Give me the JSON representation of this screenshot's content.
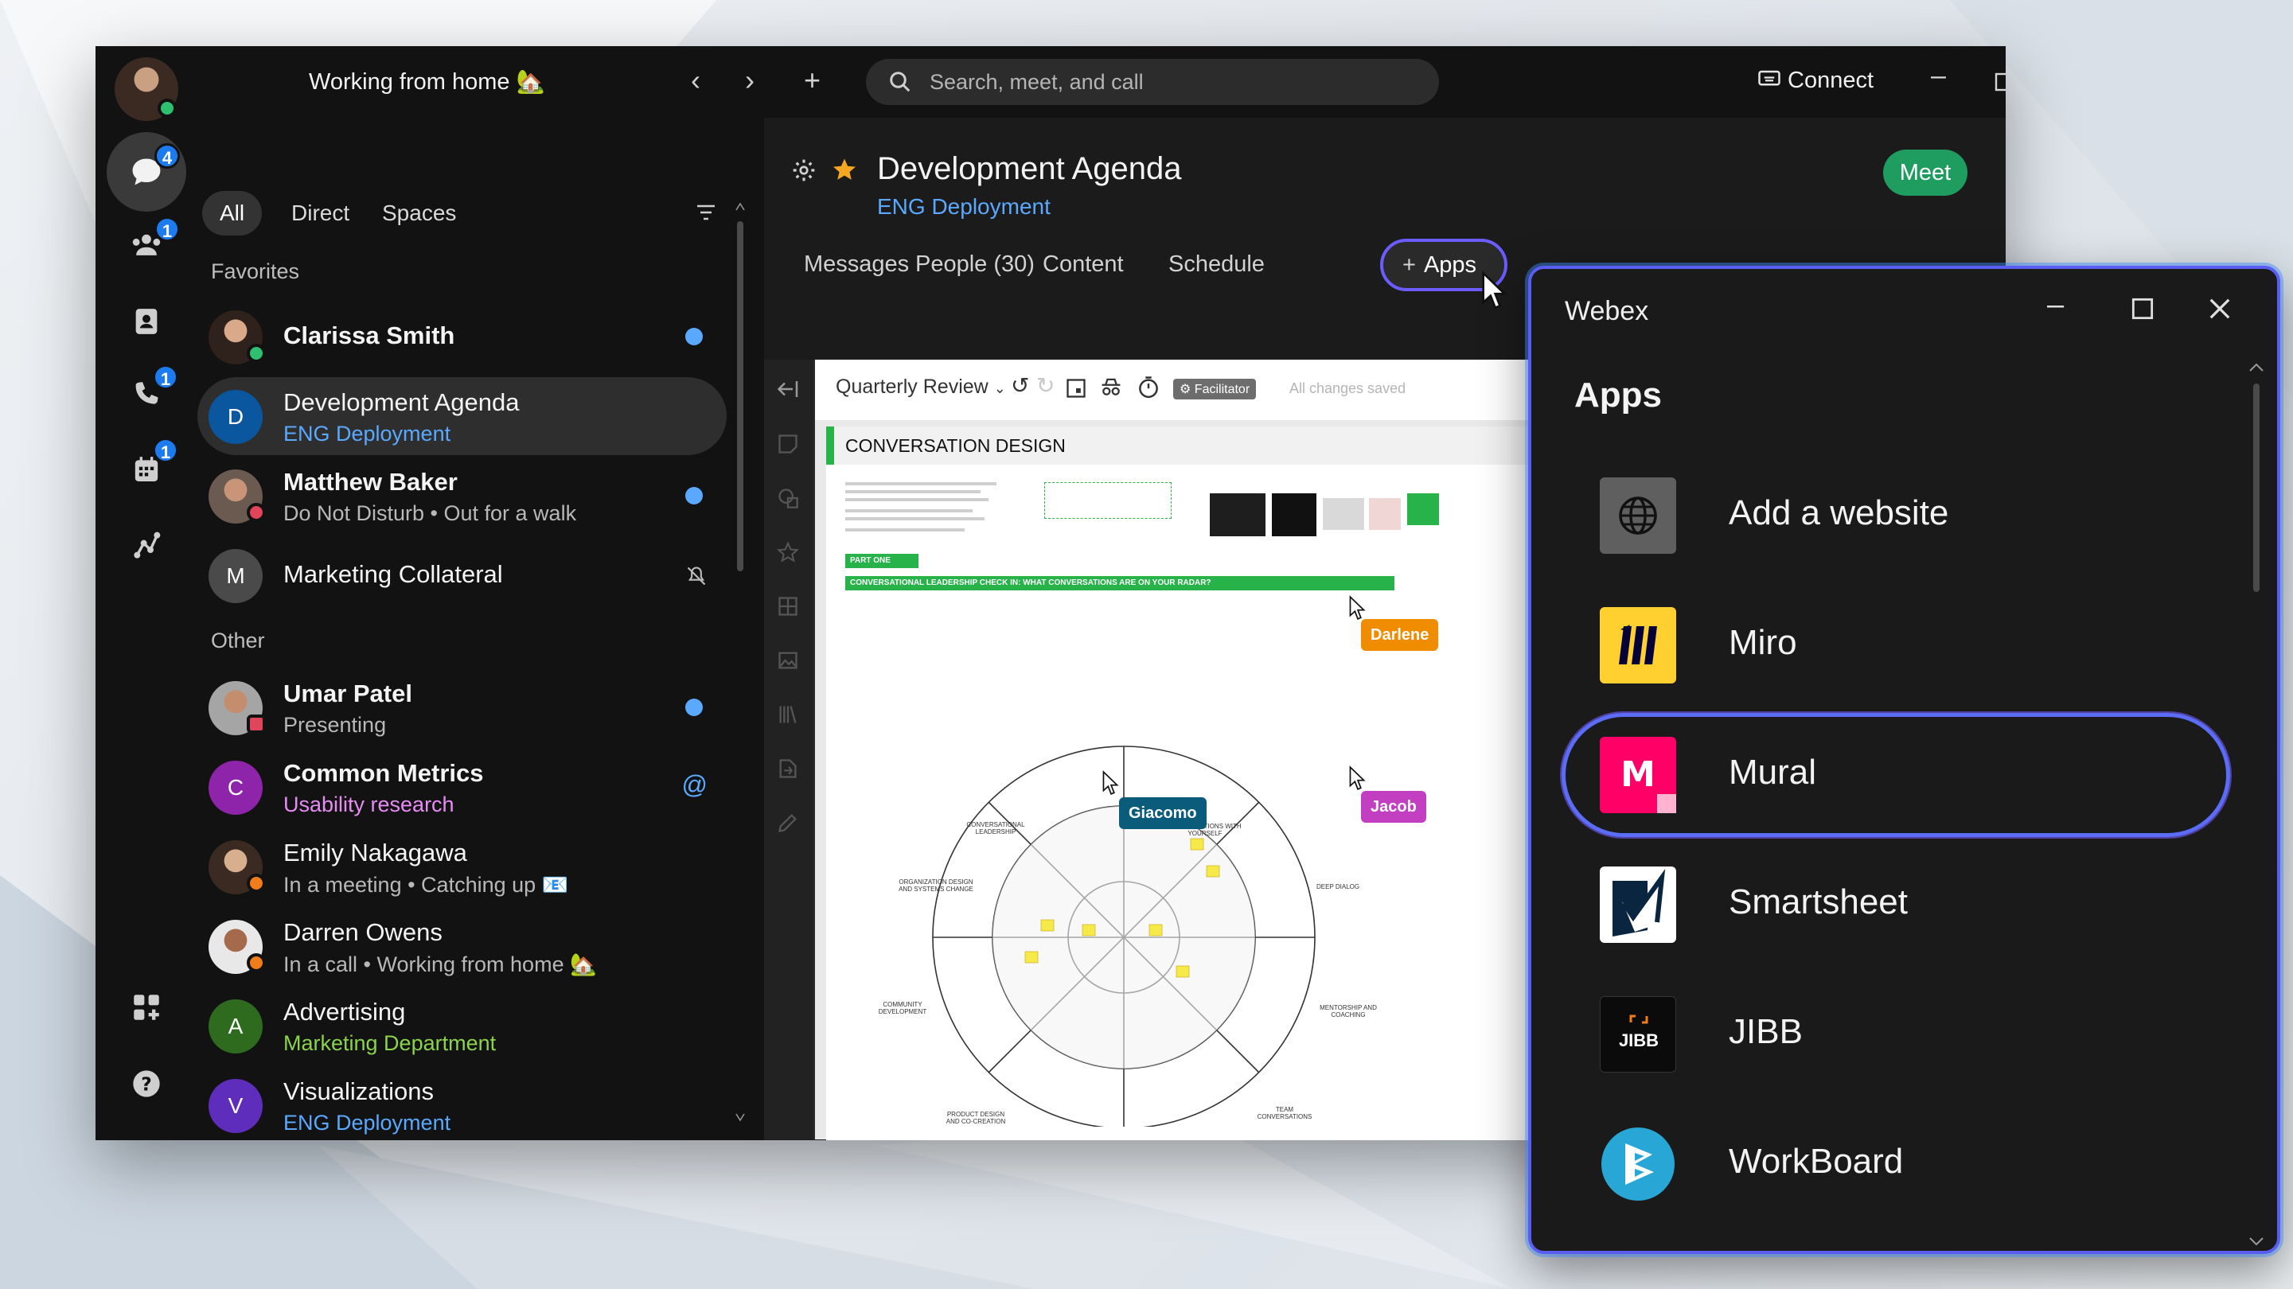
{
  "header": {
    "status_text": "Working from home 🏡",
    "search_placeholder": "Search, meet, and call",
    "connect_label": "Connect"
  },
  "rail": {
    "badges": {
      "messaging": "4",
      "teams": "1",
      "calling": "1",
      "meetings": "1"
    }
  },
  "filters": {
    "all": "All",
    "direct": "Direct",
    "spaces": "Spaces"
  },
  "sections": {
    "favorites": "Favorites",
    "other": "Other"
  },
  "conversations": [
    {
      "title": "Clarissa Smith",
      "subtitle": "",
      "avatar": ""
    },
    {
      "title": "Development Agenda",
      "subtitle": "ENG Deployment",
      "avatar": "D"
    },
    {
      "title": "Matthew Baker",
      "subtitle": "Do Not Disturb  •  Out for a walk",
      "avatar": ""
    },
    {
      "title": "Marketing Collateral",
      "subtitle": "",
      "avatar": "M"
    },
    {
      "title": "Umar Patel",
      "subtitle": "Presenting",
      "avatar": ""
    },
    {
      "title": "Common Metrics",
      "subtitle": "Usability research",
      "avatar": "C"
    },
    {
      "title": "Emily Nakagawa",
      "subtitle": "In a meeting  •  Catching up 📧",
      "avatar": ""
    },
    {
      "title": "Darren Owens",
      "subtitle": "In a call  •  Working from home 🏡",
      "avatar": ""
    },
    {
      "title": "Advertising",
      "subtitle": "Marketing Department",
      "avatar": "A"
    },
    {
      "title": "Visualizations",
      "subtitle": "ENG Deployment",
      "avatar": "V"
    }
  ],
  "mentions_symbol": "@",
  "space": {
    "title": "Development Agenda",
    "subtitle": "ENG Deployment",
    "meet_label": "Meet",
    "tabs": {
      "messages": "Messages",
      "people": "People (30)",
      "content": "Content",
      "schedule": "Schedule",
      "apps": "Apps"
    }
  },
  "whiteboard": {
    "board_name": "Quarterly Review",
    "facilitator_label": "Facilitator",
    "save_status": "All changes saved",
    "section_title": "CONVERSATION DESIGN",
    "part_label": "PART ONE",
    "check_in_title": "CONVERSATIONAL LEADERSHIP CHECK IN: WHAT CONVERSATIONS ARE ON YOUR RADAR?",
    "cursors": {
      "darlene": "Darlene",
      "giacomo": "Giacomo",
      "jacob": "Jacob"
    },
    "colors": {
      "darlene": "#f08c00",
      "giacomo": "#0b5c7a",
      "jacob": "#c33fc2",
      "section_green": "#27b24a"
    },
    "radar_labels": {
      "top_left": "CONVERSATIONAL LEADERSHIP",
      "top_right": "CONVERSATIONS WITH YOURSELF",
      "left": "ORGANIZATION DESIGN AND SYSTEMS CHANGE",
      "right": "DEEP DIALOG",
      "lower_left": "COMMUNITY DEVELOPMENT",
      "lower_right": "MENTORSHIP AND COACHING",
      "bottom_left": "PRODUCT DESIGN AND CO-CREATION",
      "bottom_right": "TEAM CONVERSATIONS"
    }
  },
  "apps_window": {
    "window_title": "Webex",
    "heading": "Apps",
    "apps": [
      {
        "name": "Add a website",
        "icon": "globe-icon"
      },
      {
        "name": "Miro",
        "icon": "miro-logo"
      },
      {
        "name": "Mural",
        "icon": "mural-logo"
      },
      {
        "name": "Smartsheet",
        "icon": "smartsheet-logo"
      },
      {
        "name": "JIBB",
        "icon": "jibb-logo",
        "logo_text": "JIBB"
      },
      {
        "name": "WorkBoard",
        "icon": "workboard-logo"
      }
    ]
  },
  "accent_colors": {
    "selection_blue": "#5aa9ff",
    "meet_green": "#1f9d61",
    "apps_outline": "#5b5cf0",
    "badge_blue": "#1d7bf0"
  }
}
